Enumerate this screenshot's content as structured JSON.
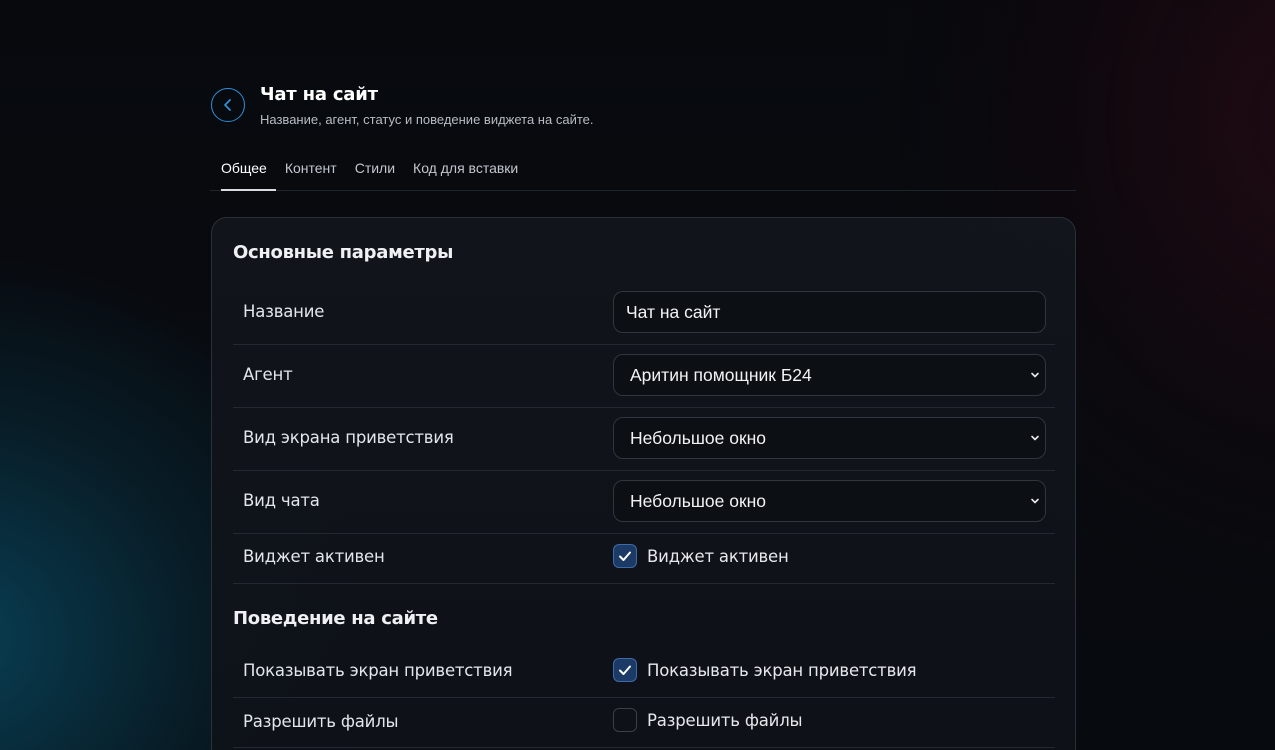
{
  "header": {
    "title": "Чат на сайт",
    "subtitle": "Название, агент, статус и поведение виджета на сайте."
  },
  "tabs": [
    {
      "label": "Общее",
      "active": true
    },
    {
      "label": "Контент",
      "active": false
    },
    {
      "label": "Стили",
      "active": false
    },
    {
      "label": "Код для вставки",
      "active": false
    }
  ],
  "sections": {
    "main": {
      "title": "Основные параметры",
      "name": {
        "label": "Название",
        "value": "Чат на сайт"
      },
      "agent": {
        "label": "Агент",
        "value": "Аритин помощник Б24"
      },
      "welcome_view": {
        "label": "Вид экрана приветствия",
        "value": "Небольшое окно"
      },
      "chat_view": {
        "label": "Вид чата",
        "value": "Небольшое окно"
      },
      "widget_active": {
        "label": "Виджет активен",
        "checkbox_label": "Виджет активен",
        "checked": true
      }
    },
    "behavior": {
      "title": "Поведение на сайте",
      "show_welcome": {
        "label": "Показывать экран приветствия",
        "checkbox_label": "Показывать экран приветствия",
        "checked": true
      },
      "allow_files": {
        "label": "Разрешить файлы",
        "checkbox_label": "Разрешить файлы",
        "checked": false
      }
    }
  },
  "icons": {
    "back": "chevron-left-icon",
    "select": "chevron-down-icon",
    "check": "check-icon"
  },
  "colors": {
    "accent": "#2f8fd8",
    "checkbox_checked": "#1c3a66"
  }
}
